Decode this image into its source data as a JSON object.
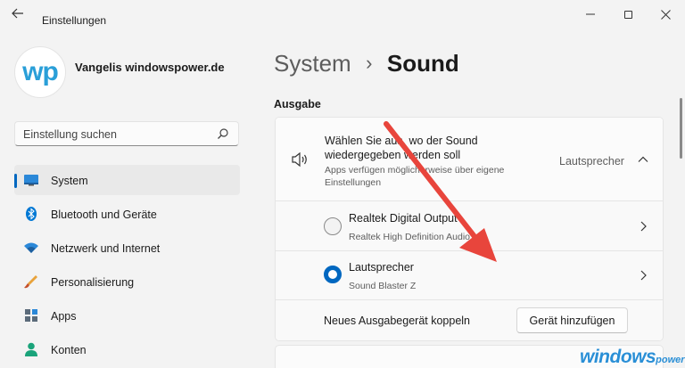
{
  "window": {
    "title": "Einstellungen",
    "controls": {
      "minimize": "—",
      "close": "✕"
    }
  },
  "user": {
    "name": "Vangelis windowspower.de",
    "avatar_w": "w",
    "avatar_p": "p"
  },
  "search": {
    "placeholder": "Einstellung suchen"
  },
  "sidebar": {
    "items": [
      {
        "label": "System",
        "icon": "monitor-icon",
        "active": true
      },
      {
        "label": "Bluetooth und Geräte",
        "icon": "bluetooth-icon"
      },
      {
        "label": "Netzwerk und Internet",
        "icon": "wifi-icon"
      },
      {
        "label": "Personalisierung",
        "icon": "brush-icon"
      },
      {
        "label": "Apps",
        "icon": "apps-icon"
      },
      {
        "label": "Konten",
        "icon": "person-icon"
      }
    ]
  },
  "breadcrumb": {
    "parent": "System",
    "separator": "›",
    "current": "Sound"
  },
  "section": {
    "output_label": "Ausgabe"
  },
  "output": {
    "header_title": "Wählen Sie aus, wo der Sound wiedergegeben werden soll",
    "header_desc": "Apps verfügen möglicherweise über eigene Einstellungen",
    "selected_value": "Lautsprecher",
    "devices": [
      {
        "name": "Realtek Digital Output",
        "sub": "Realtek High Definition Audio",
        "selected": false
      },
      {
        "name": "Lautsprecher",
        "sub": "Sound Blaster Z",
        "selected": true
      }
    ],
    "pair_label": "Neues Ausgabegerät koppeln",
    "add_button": "Gerät hinzufügen"
  },
  "watermark": {
    "main": "windows",
    "sub": "power"
  },
  "colors": {
    "accent": "#0067c0",
    "arrow": "#e8453c",
    "watermark": "#2a8fd6"
  }
}
